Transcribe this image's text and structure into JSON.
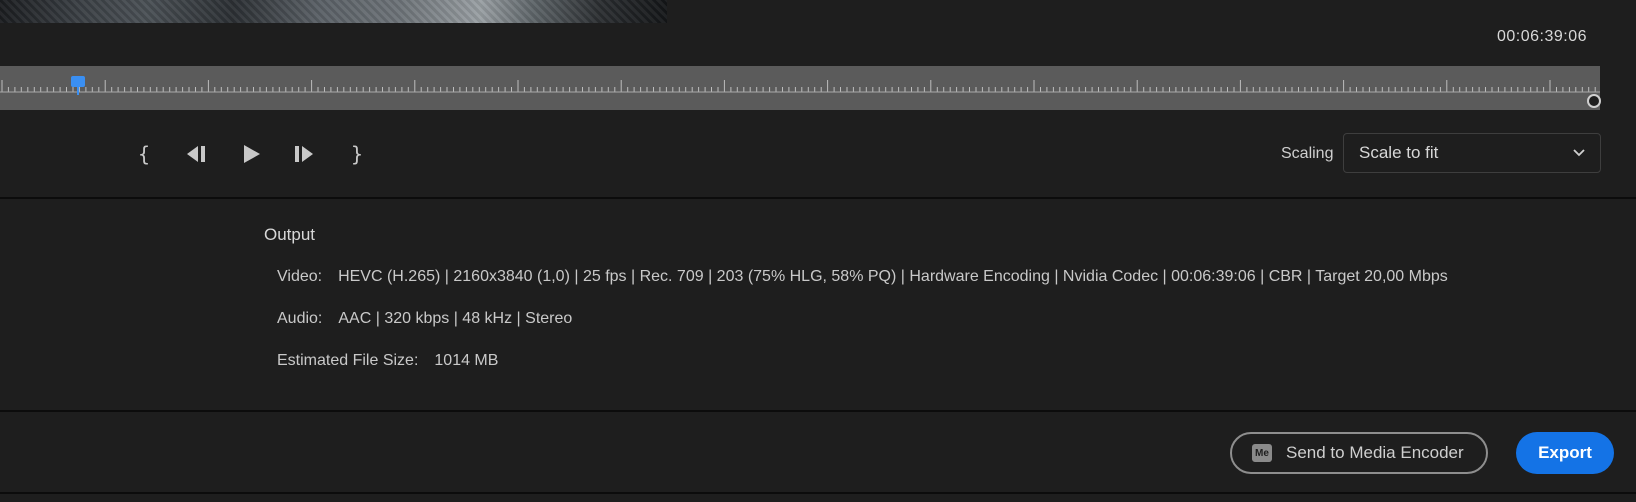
{
  "preview": {
    "timecode": "00:06:39:06"
  },
  "transport": {
    "mark_in": "{",
    "mark_out": "}"
  },
  "scaling": {
    "label": "Scaling",
    "selected": "Scale to fit"
  },
  "output": {
    "title": "Output",
    "video_label": "Video:",
    "video_value": "HEVC (H.265) | 2160x3840 (1,0) | 25 fps | Rec. 709 | 203 (75% HLG, 58% PQ) | Hardware Encoding | Nvidia Codec | 00:06:39:06  | CBR | Target 20,00 Mbps",
    "audio_label": "Audio:",
    "audio_value": "AAC | 320 kbps | 48 kHz | Stereo",
    "filesize_label": "Estimated File Size:",
    "filesize_value": "1014 MB"
  },
  "footer": {
    "send_to_ame_label": "Send to Media Encoder",
    "me_badge": "Me",
    "export_label": "Export"
  },
  "colors": {
    "accent": "#1473e6",
    "playhead": "#3a8ff2",
    "background": "#1e1e1e",
    "timeline": "#5b5b5b"
  },
  "icons": [
    "mark-in-icon",
    "step-back-icon",
    "play-icon",
    "step-forward-icon",
    "mark-out-icon",
    "chevron-down-icon",
    "media-encoder-icon"
  ]
}
